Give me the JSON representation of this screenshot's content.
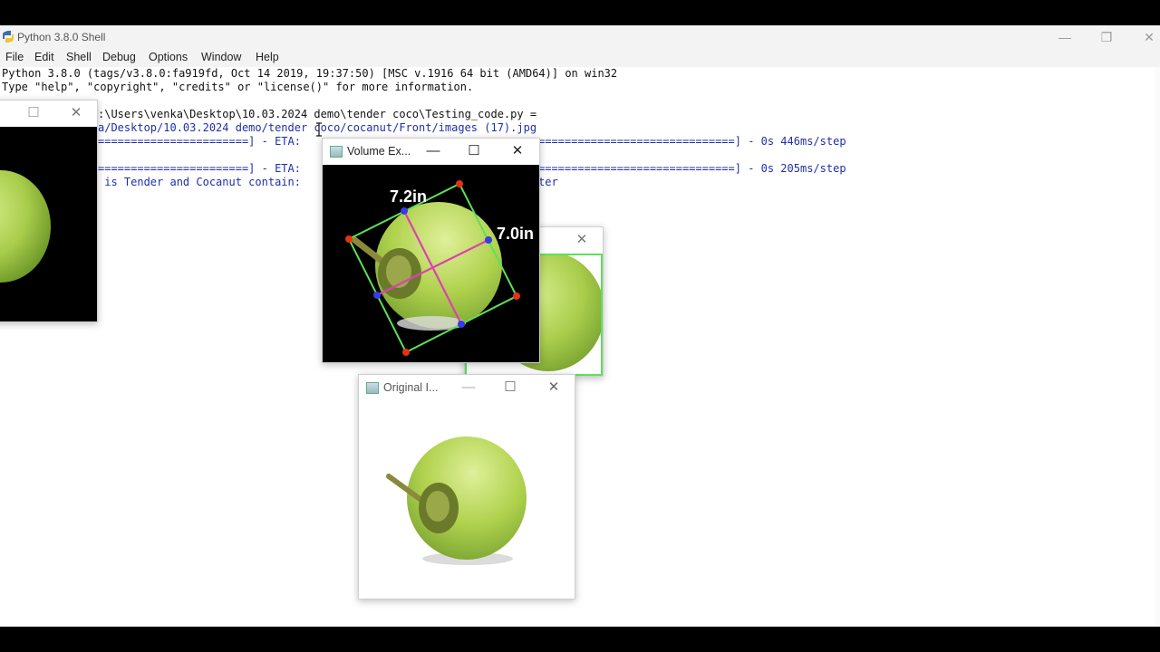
{
  "window": {
    "title": "Python 3.8.0 Shell",
    "controls": {
      "minimize": "—",
      "restore": "❐",
      "close": "✕"
    }
  },
  "menu": [
    "File",
    "Edit",
    "Shell",
    "Debug",
    "Options",
    "Window",
    "Help"
  ],
  "shell": {
    "lines": [
      "Python 3.8.0 (tags/v3.8.0:fa919fd, Oct 14 2019, 19:37:50) [MSC v.1916 64 bit (AMD64)] on win32",
      "Type \"help\", \"copyright\", \"credits\" or \"license()\" for more information.",
      ":\\Users\\venka\\Desktop\\10.03.2024 demo\\tender coco\\Testing_code.py =",
      "a/Desktop/10.03.2024 demo/tender coco/cocanut/Front/images (17).jpg",
      "=======================] - ETA:",
      "==============================] - 0s 446ms/step",
      "=======================] - ETA:",
      "==============================] - 0s 205ms/step",
      " is Tender and Cocanut contain:",
      "ter"
    ]
  },
  "cv_windows": {
    "volume": {
      "title": "Volume Ex...",
      "label_a": "7.2in",
      "label_b": "7.0in"
    },
    "original": {
      "title": "Original I..."
    }
  },
  "colors": {
    "coconut": "#a8cc4a",
    "box": "#5ee05a",
    "axis": "#e040b0",
    "corner": "#e83015",
    "midpoint": "#3a3ae8",
    "shell_blue": "#1f2fa8"
  }
}
